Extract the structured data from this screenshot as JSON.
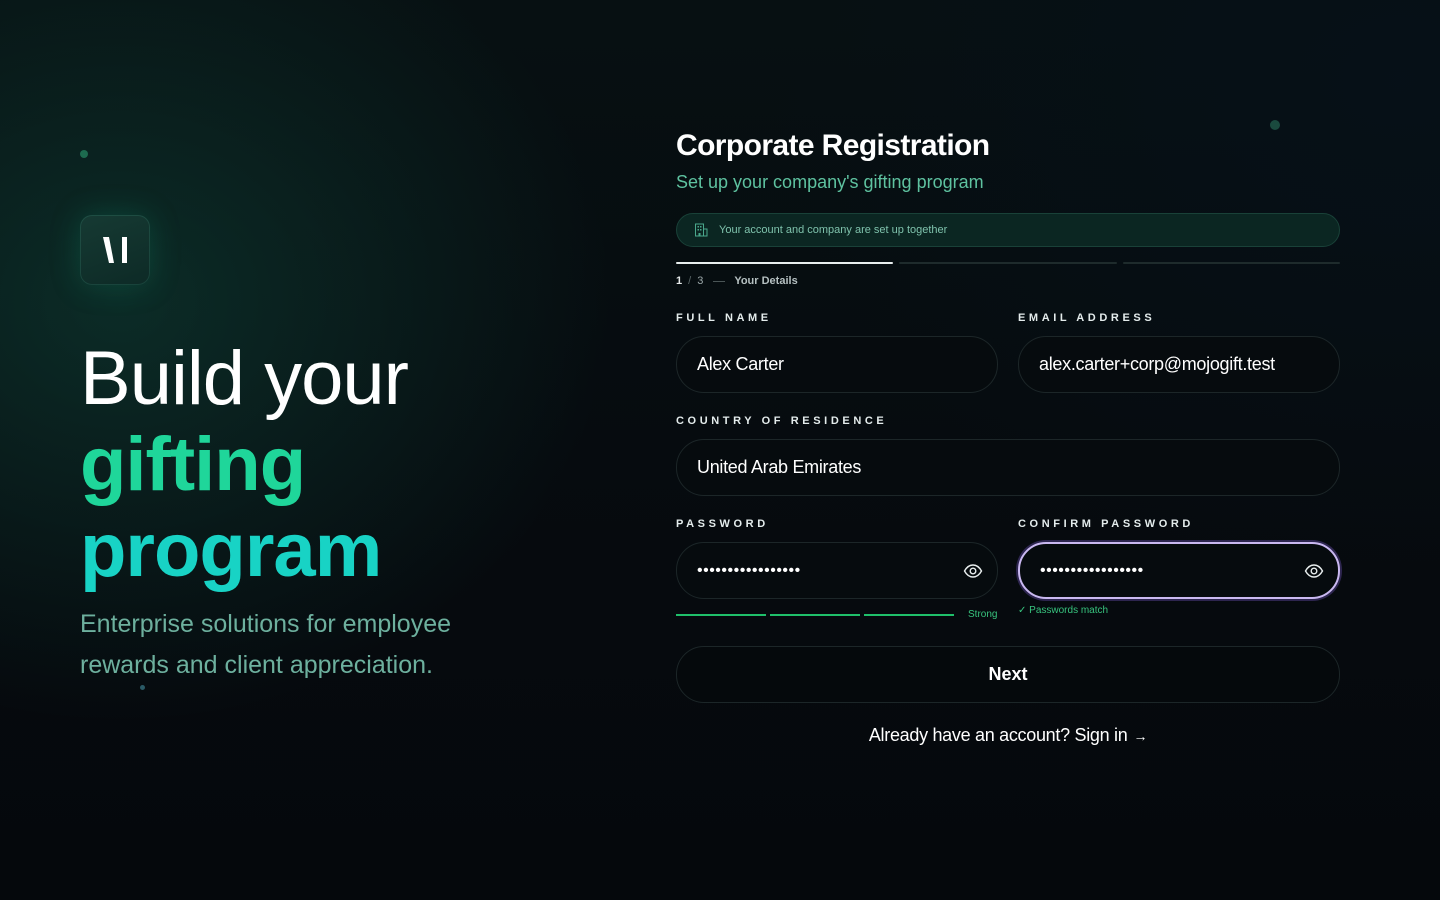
{
  "hero": {
    "title_line1": "Build your",
    "title_line2": "gifting",
    "title_line3": "program",
    "subtitle": "Enterprise solutions for employee rewards and client appreciation."
  },
  "form": {
    "title": "Corporate Registration",
    "subtitle": "Set up your company's gifting program",
    "notice": "Your account and company are set up together",
    "step": {
      "current": "1",
      "total": "3",
      "label": "Your Details",
      "progress_segments": 3,
      "active_segments": 1
    },
    "fields": {
      "full_name": {
        "label": "FULL NAME",
        "value": "Alex Carter"
      },
      "email": {
        "label": "EMAIL ADDRESS",
        "value": "alex.carter+corp@mojogift.test"
      },
      "country": {
        "label": "COUNTRY OF RESIDENCE",
        "value": "United Arab Emirates"
      },
      "password": {
        "label": "PASSWORD",
        "value": "•••••••••••••••••"
      },
      "confirm_password": {
        "label": "CONFIRM PASSWORD",
        "value": "•••••••••••••••••"
      }
    },
    "password_strength": "Strong",
    "password_match": "✓ Passwords match",
    "next_label": "Next",
    "signin_text": "Already have an account? Sign in",
    "signin_arrow": "→"
  },
  "colors": {
    "accent_green": "#1fd69a",
    "accent_teal": "#18d3c5",
    "success": "#38c47e",
    "focus_ring": "#c9b8f0"
  },
  "icons": [
    "logo-mark-icon",
    "building-icon",
    "eye-icon",
    "arrow-right-icon"
  ]
}
